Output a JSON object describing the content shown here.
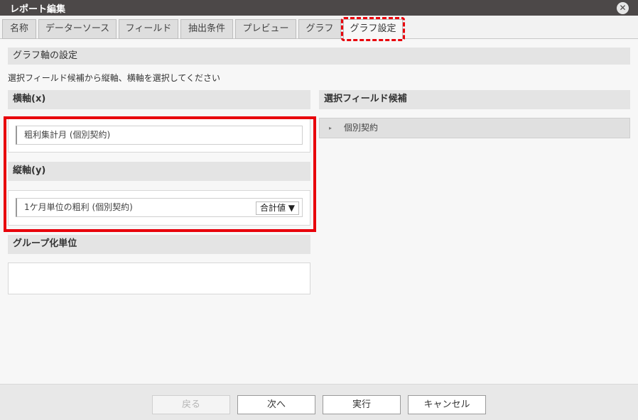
{
  "window": {
    "title": "レポート編集",
    "close_label": "✕"
  },
  "tabs": [
    {
      "label": "名称"
    },
    {
      "label": "データーソース"
    },
    {
      "label": "フィールド"
    },
    {
      "label": "抽出条件"
    },
    {
      "label": "プレビュー"
    },
    {
      "label": "グラフ"
    },
    {
      "label": "グラフ設定",
      "active": true
    }
  ],
  "main": {
    "section_title": "グラフ軸の設定",
    "instruction": "選択フィールド候補から縦軸、横軸を選択してください",
    "x_axis": {
      "label": "横軸(x)",
      "field": "粗利集計月 (個別契約)"
    },
    "y_axis": {
      "label": "縦軸(y)",
      "field": "1ケ月単位の粗利 (個別契約)",
      "aggregation": "合計値 ▼"
    },
    "group": {
      "label": "グループ化単位"
    },
    "candidates": {
      "label": "選択フィールド候補",
      "items": [
        {
          "label": "個別契約",
          "expander": "▸"
        }
      ]
    }
  },
  "footer": {
    "back": "戻る",
    "next": "次へ",
    "run": "実行",
    "cancel": "キャンセル"
  },
  "colors": {
    "highlight_red": "#e8000b",
    "titlebar": "#4c4848"
  }
}
